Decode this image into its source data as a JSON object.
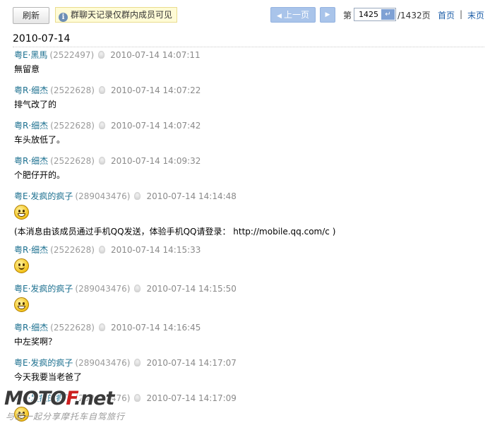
{
  "toolbar": {
    "refresh_label": "刷新",
    "notice_text": "群聊天记录仅群内成员可见",
    "prev_label": "上一页",
    "page_prefix": "第",
    "current_page": "1425",
    "total_pages": "/1432页",
    "first_label": "首页",
    "separator": "|",
    "last_label": "末页"
  },
  "date_header": "2010-07-14",
  "messages": [
    {
      "sender": "粤E·黑馬",
      "qq": "(2522497)",
      "time": "2010-07-14 14:07:11",
      "text": "無留意"
    },
    {
      "sender": "粤R·细杰",
      "qq": "(2522628)",
      "time": "2010-07-14 14:07:22",
      "text": "排气改了的"
    },
    {
      "sender": "粤R·细杰",
      "qq": "(2522628)",
      "time": "2010-07-14 14:07:42",
      "text": "车头放低了。"
    },
    {
      "sender": "粤R·细杰",
      "qq": "(2522628)",
      "time": "2010-07-14 14:09:32",
      "text": "个肥仔开的。"
    },
    {
      "sender": "粤E·发疯的疯子",
      "qq": "(289043476)",
      "time": "2010-07-14 14:14:48",
      "emoticon": "grin-emoticon",
      "text": "(本消息由该成员通过手机QQ发送，体验手机QQ请登录： http://mobile.qq.com/c )"
    },
    {
      "sender": "粤R·细杰",
      "qq": "(2522628)",
      "time": "2010-07-14 14:15:33",
      "emoticon": "smile-emoticon"
    },
    {
      "sender": "粤E·发疯的疯子",
      "qq": "(289043476)",
      "time": "2010-07-14 14:15:50",
      "emoticon": "grin-emoticon"
    },
    {
      "sender": "粤R·细杰",
      "qq": "(2522628)",
      "time": "2010-07-14 14:16:45",
      "text": "中左奖啊？"
    },
    {
      "sender": "粤E·发疯的疯子",
      "qq": "(289043476)",
      "time": "2010-07-14 14:17:07",
      "text": "今天我要当老爸了"
    },
    {
      "sender": "粤E·发疯的疯子",
      "qq": "(289043476)",
      "time": "2010-07-14 14:17:09",
      "emoticon": "grin-emoticon"
    }
  ],
  "watermark": {
    "logo_prefix": "MOTO",
    "logo_accent": "F",
    "logo_suffix": ".net",
    "tagline": "与您一起分享摩托车自驾旅行"
  },
  "colors": {
    "sender": "#1b6f8f",
    "link": "#1d5ea8",
    "nav_button": "#a9c4ea",
    "notice_bg": "#fffbd6"
  }
}
